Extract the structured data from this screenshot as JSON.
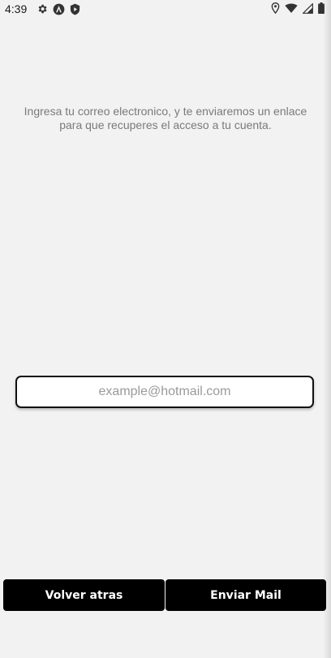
{
  "status_bar": {
    "time": "4:39",
    "left_icons": [
      "gear-icon",
      "navigation-a-icon",
      "shield-play-icon"
    ],
    "right_icons": [
      "location-icon",
      "wifi-icon",
      "signal-icon",
      "battery-icon"
    ]
  },
  "recovery": {
    "instruction": "Ingresa tu correo electronico, y te enviaremos un enlace para que recuperes el acceso a tu cuenta.",
    "email_placeholder": "example@hotmail.com",
    "email_value": ""
  },
  "actions": {
    "back_label": "Volver atras",
    "send_label": "Enviar Mail"
  },
  "colors": {
    "background": "#f2f2f2",
    "button_bg": "#000000",
    "button_text": "#ffffff",
    "instruction_text": "#7a7a7a",
    "placeholder_text": "#9a9a9a"
  }
}
